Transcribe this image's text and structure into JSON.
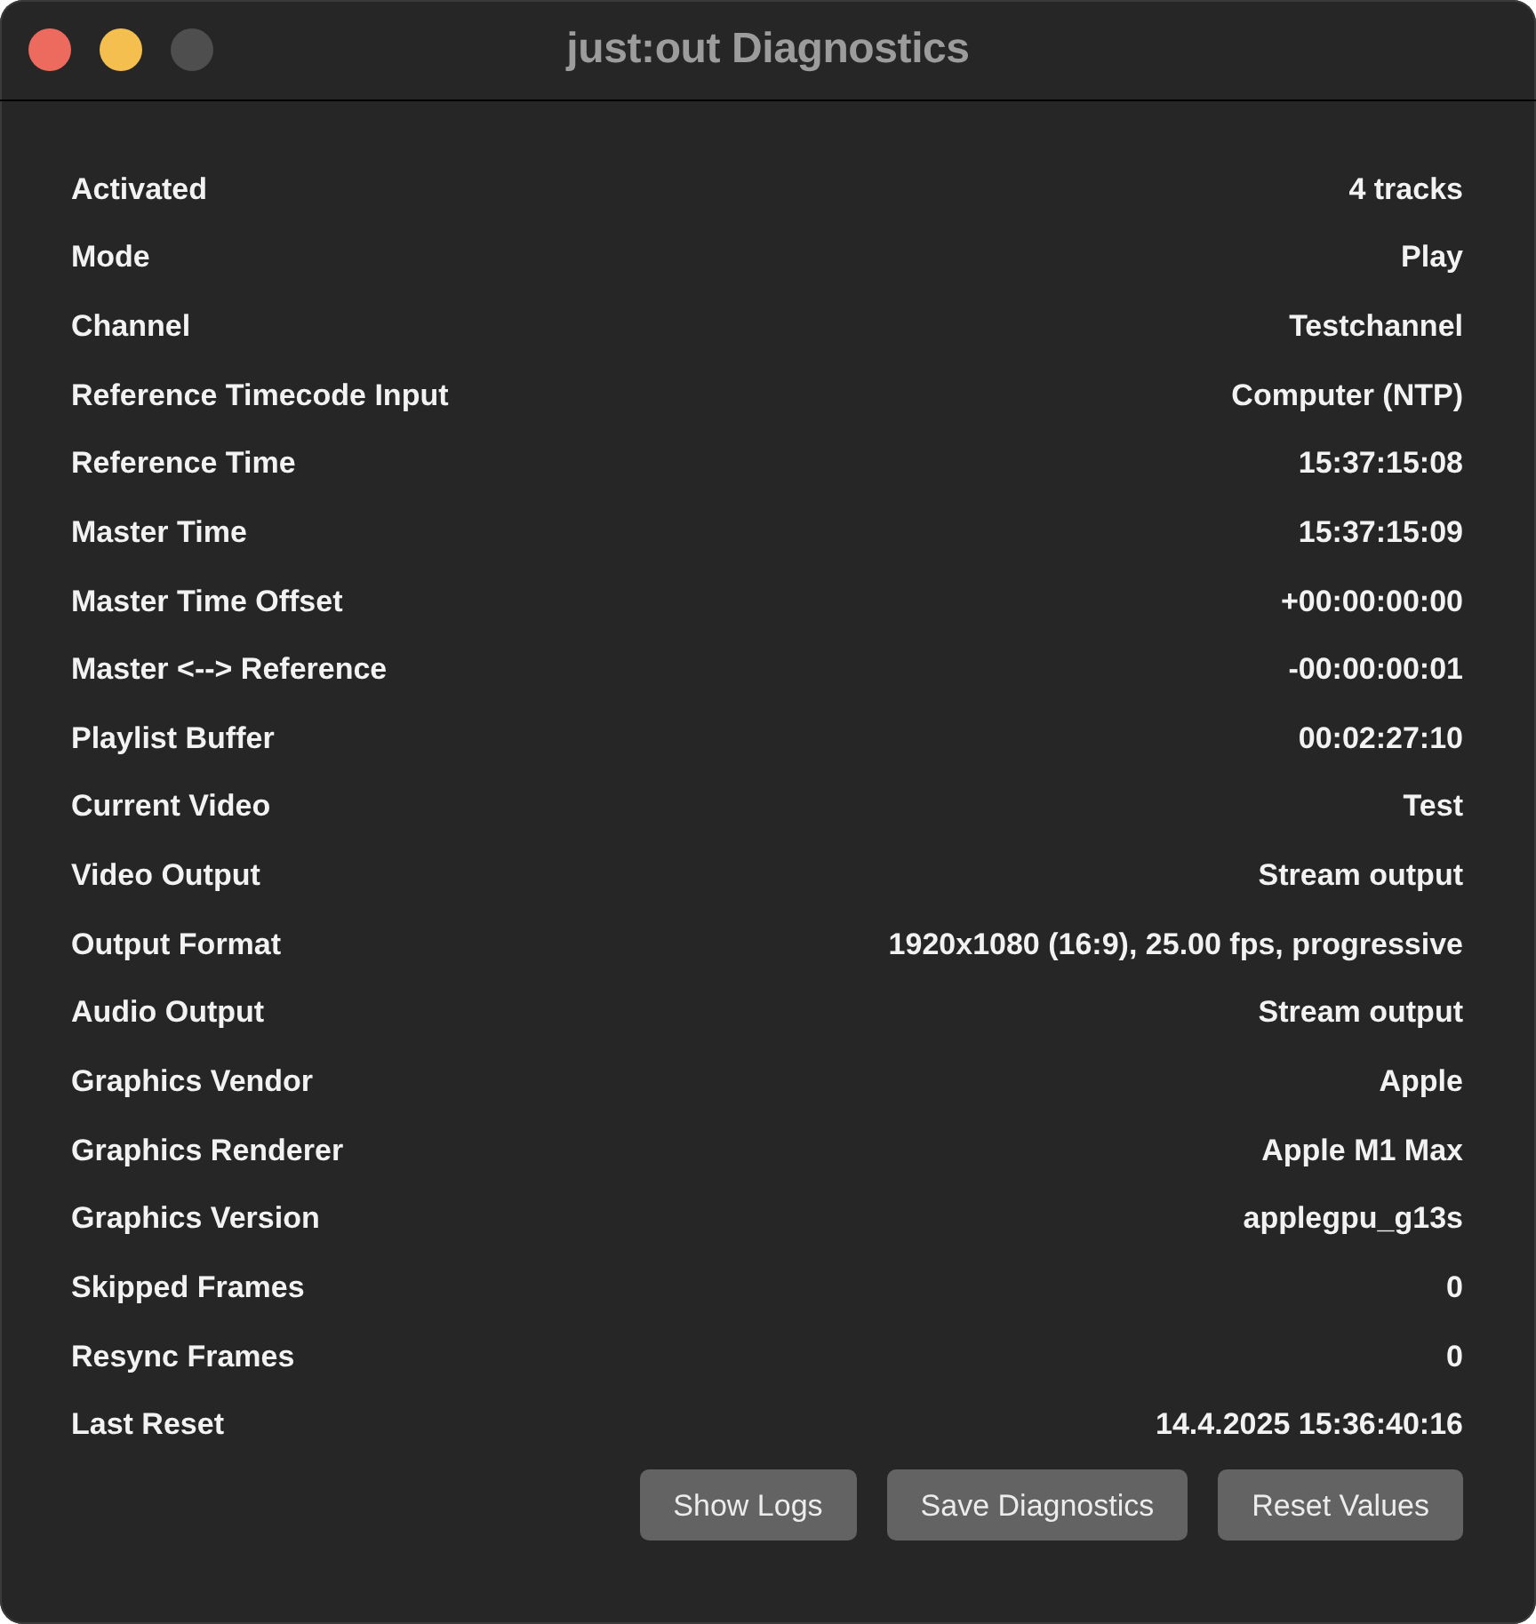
{
  "window": {
    "title": "just:out Diagnostics",
    "controls": [
      {
        "kind": "close",
        "disabled": false
      },
      {
        "kind": "minimize",
        "disabled": false
      },
      {
        "kind": "zoom",
        "disabled": true
      }
    ]
  },
  "rows": [
    {
      "label": "Activated",
      "value": "4 tracks"
    },
    {
      "label": "Mode",
      "value": "Play"
    },
    {
      "label": "Channel",
      "value": "Testchannel"
    },
    {
      "label": "Reference Timecode Input",
      "value": "Computer (NTP)"
    },
    {
      "label": "Reference Time",
      "value": "15:37:15:08"
    },
    {
      "label": "Master Time",
      "value": "15:37:15:09"
    },
    {
      "label": "Master Time Offset",
      "value": "+00:00:00:00"
    },
    {
      "label": "Master <--> Reference",
      "value": "-00:00:00:01"
    },
    {
      "label": "Playlist Buffer",
      "value": "00:02:27:10"
    },
    {
      "label": "Current Video",
      "value": "Test"
    },
    {
      "label": "Video Output",
      "value": "Stream output"
    },
    {
      "label": "Output Format",
      "value": "1920x1080 (16:9), 25.00 fps, progressive"
    },
    {
      "label": "Audio Output",
      "value": "Stream output"
    },
    {
      "label": "Graphics Vendor",
      "value": "Apple"
    },
    {
      "label": "Graphics Renderer",
      "value": "Apple M1 Max"
    },
    {
      "label": "Graphics Version",
      "value": "applegpu_g13s"
    },
    {
      "label": "Skipped Frames",
      "value": "0"
    },
    {
      "label": "Resync Frames",
      "value": "0"
    },
    {
      "label": "Last Reset",
      "value": "14.4.2025 15:36:40:16"
    }
  ],
  "buttons": [
    "Show Logs",
    "Save Diagnostics",
    "Reset Values"
  ]
}
